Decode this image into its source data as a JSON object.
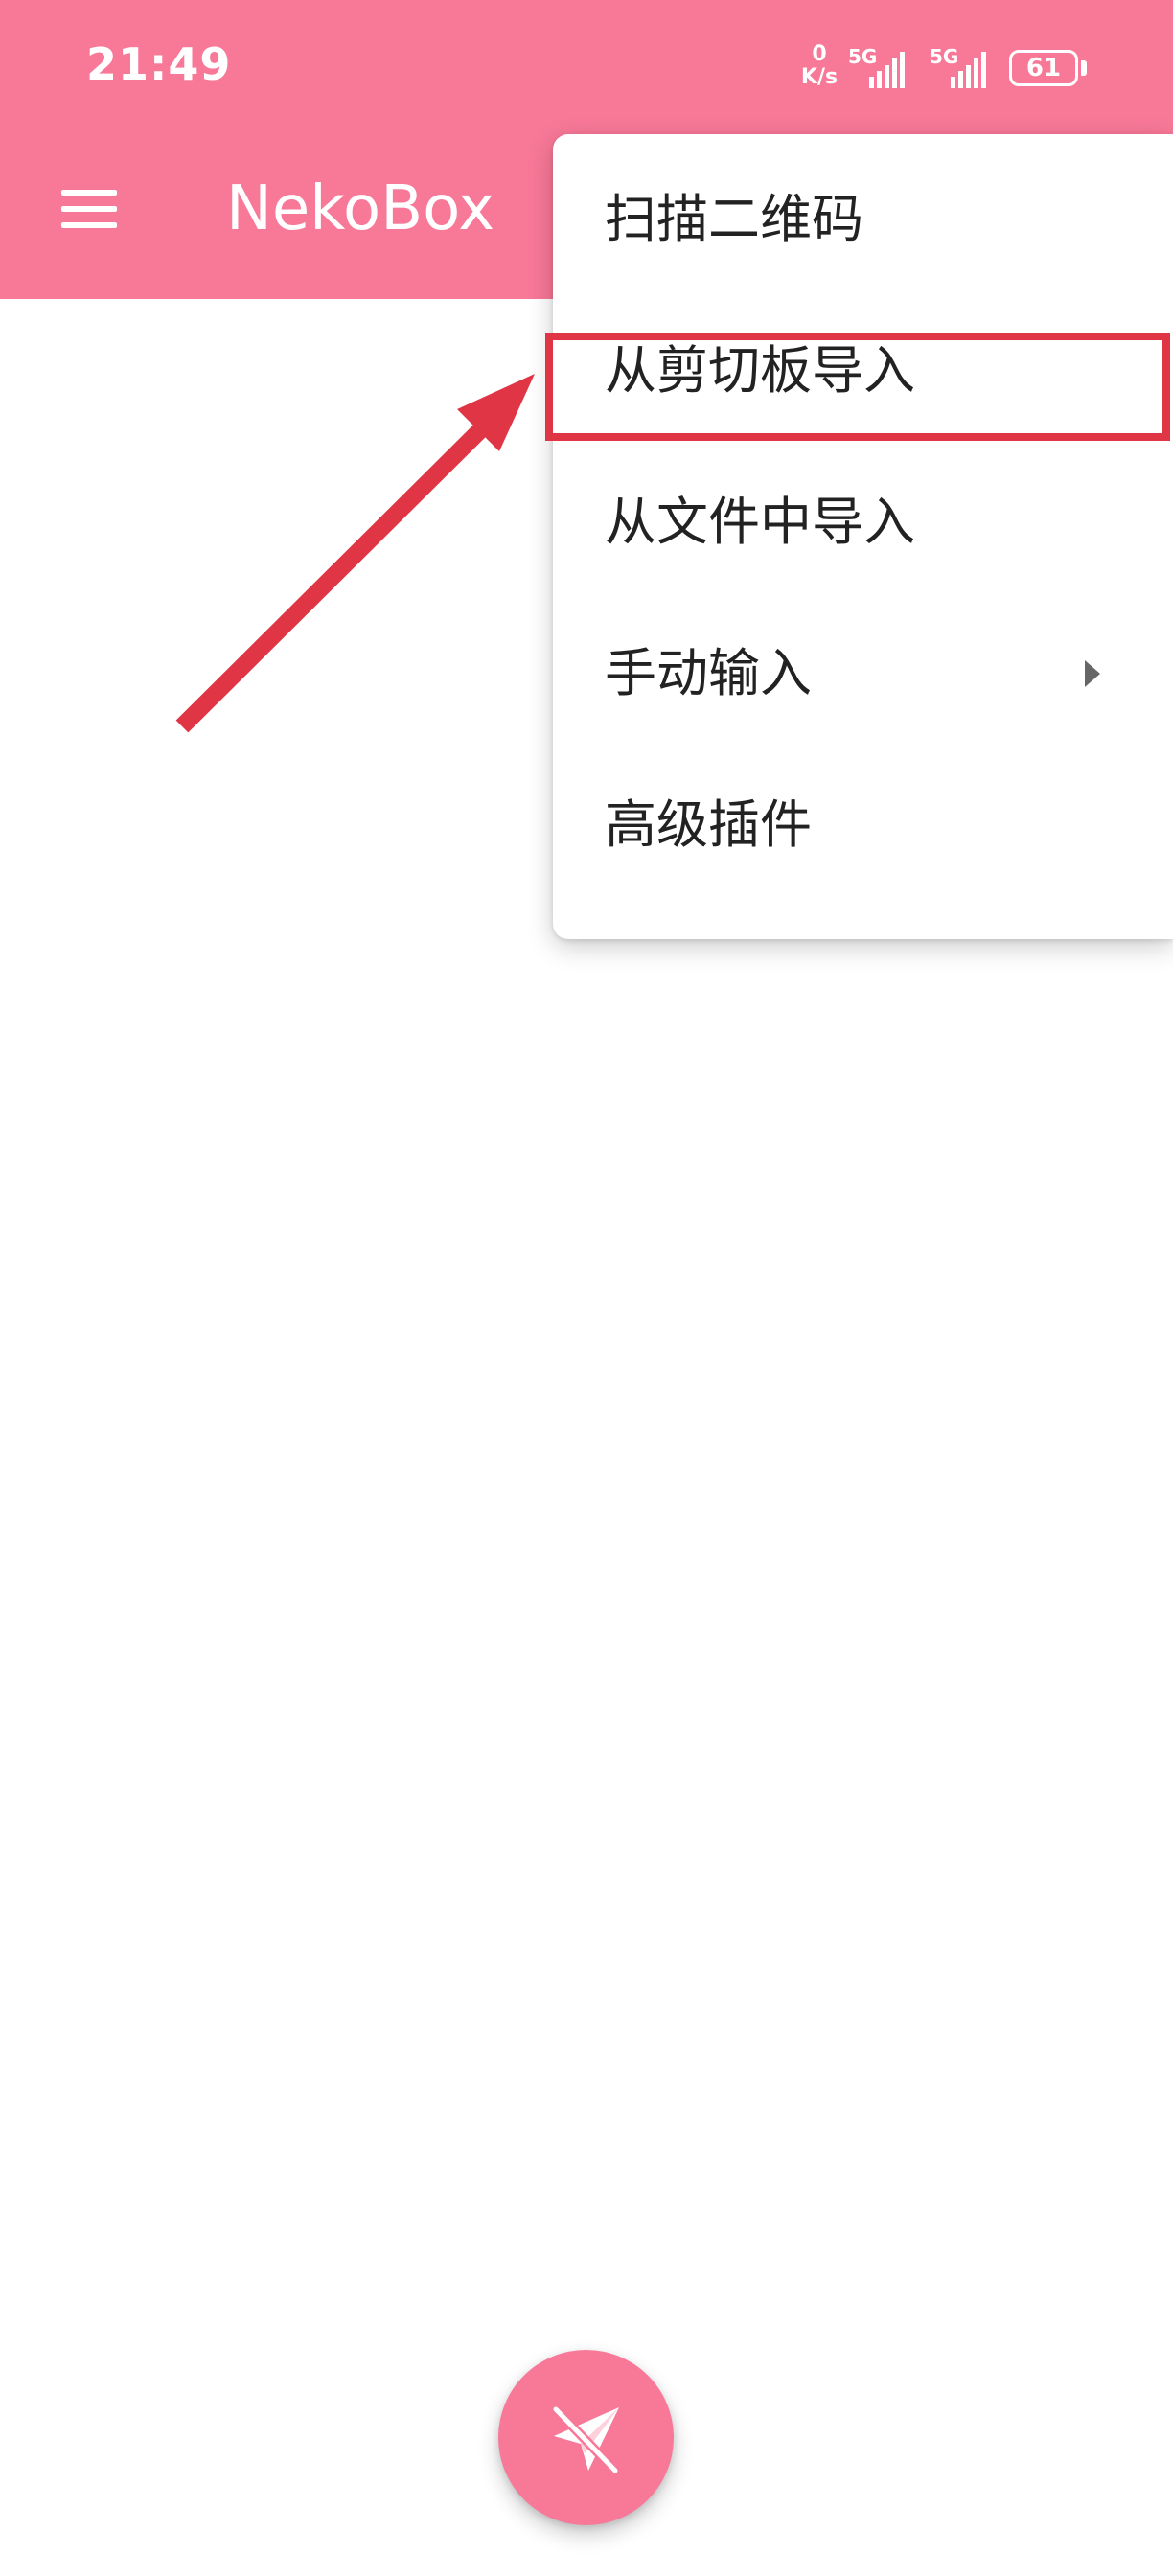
{
  "status_bar": {
    "time": "21:49",
    "net_speed_value": "0",
    "net_speed_unit": "K/s",
    "sim1_label": "5G",
    "sim2_label": "5G",
    "battery_level": "61"
  },
  "toolbar": {
    "title": "NekoBox",
    "menu_icon": "hamburger-menu-icon"
  },
  "popup_menu": {
    "items": [
      {
        "label": "扫描二维码"
      },
      {
        "label": "从剪切板导入"
      },
      {
        "label": "从文件中导入"
      },
      {
        "label": "手动输入",
        "submenu_icon": "submenu-arrow-icon"
      },
      {
        "label": "高级插件"
      }
    ]
  },
  "fab": {
    "icon": "paper-plane-off-icon"
  },
  "colors": {
    "primary": "#f87898",
    "annotation_red": "#e03545",
    "menu_text": "#222222",
    "background": "#ffffff"
  }
}
